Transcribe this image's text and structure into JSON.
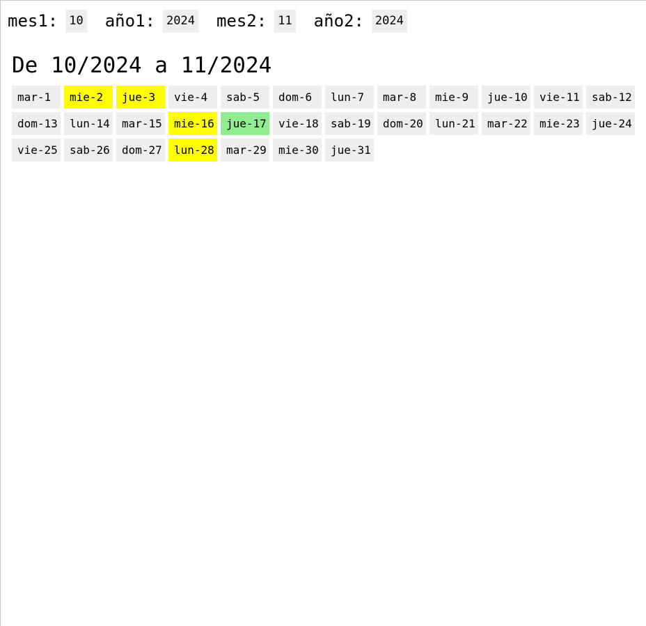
{
  "controls": {
    "mes1_label": "mes1:",
    "mes1_value": "10",
    "anio1_label": "año1:",
    "anio1_value": "2024",
    "mes2_label": "mes2:",
    "mes2_value": "11",
    "anio2_label": "año2:",
    "anio2_value": "2024"
  },
  "heading": "De 10/2024 a 11/2024",
  "colors": {
    "default": "#eeeeee",
    "yellow": "#ffff00",
    "green": "#90ee90"
  },
  "days": [
    {
      "label": "mar-1",
      "mark": ""
    },
    {
      "label": "mie-2",
      "mark": "yellow"
    },
    {
      "label": "jue-3",
      "mark": "yellow"
    },
    {
      "label": "vie-4",
      "mark": ""
    },
    {
      "label": "sab-5",
      "mark": ""
    },
    {
      "label": "dom-6",
      "mark": ""
    },
    {
      "label": "lun-7",
      "mark": ""
    },
    {
      "label": "mar-8",
      "mark": ""
    },
    {
      "label": "mie-9",
      "mark": ""
    },
    {
      "label": "jue-10",
      "mark": ""
    },
    {
      "label": "vie-11",
      "mark": ""
    },
    {
      "label": "sab-12",
      "mark": ""
    },
    {
      "label": "dom-13",
      "mark": ""
    },
    {
      "label": "lun-14",
      "mark": ""
    },
    {
      "label": "mar-15",
      "mark": ""
    },
    {
      "label": "mie-16",
      "mark": "yellow"
    },
    {
      "label": "jue-17",
      "mark": "green"
    },
    {
      "label": "vie-18",
      "mark": ""
    },
    {
      "label": "sab-19",
      "mark": ""
    },
    {
      "label": "dom-20",
      "mark": ""
    },
    {
      "label": "lun-21",
      "mark": ""
    },
    {
      "label": "mar-22",
      "mark": ""
    },
    {
      "label": "mie-23",
      "mark": ""
    },
    {
      "label": "jue-24",
      "mark": ""
    },
    {
      "label": "vie-25",
      "mark": ""
    },
    {
      "label": "sab-26",
      "mark": ""
    },
    {
      "label": "dom-27",
      "mark": ""
    },
    {
      "label": "lun-28",
      "mark": "yellow"
    },
    {
      "label": "mar-29",
      "mark": ""
    },
    {
      "label": "mie-30",
      "mark": ""
    },
    {
      "label": "jue-31",
      "mark": ""
    }
  ]
}
